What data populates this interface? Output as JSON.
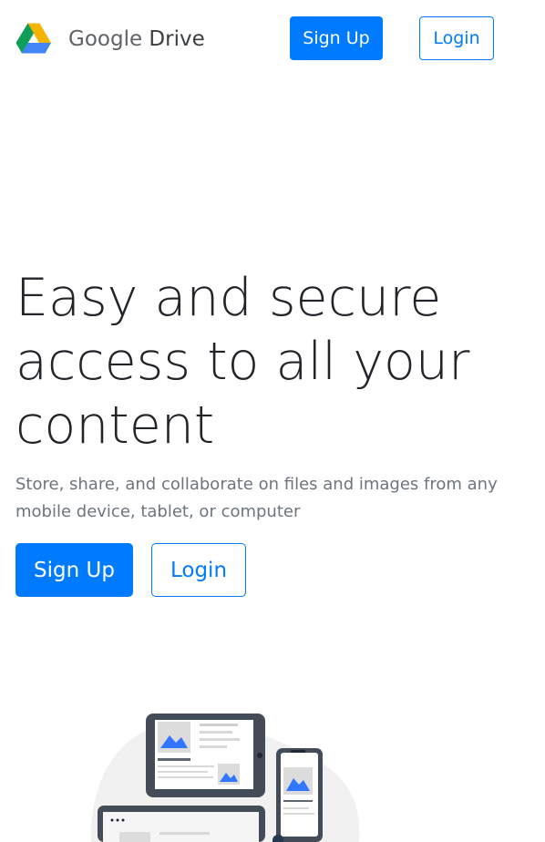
{
  "header": {
    "brand_primary": "Google",
    "brand_secondary": "Drive",
    "signup_label": "Sign Up",
    "login_label": "Login"
  },
  "hero": {
    "title": "Easy and secure access to all your content",
    "subtitle": "Store, share, and collaborate on files and images from any mobile device, tablet, or computer",
    "signup_label": "Sign Up",
    "login_label": "Login"
  },
  "icons": {
    "logo": "google-drive-logo-icon",
    "illustration": "devices-illustration-icon"
  },
  "colors": {
    "primary": "#007bff",
    "text": "#212529",
    "muted": "#6c757d",
    "drive_green": "#0f9d58",
    "drive_yellow": "#f4b400",
    "drive_blue": "#4285f4"
  }
}
